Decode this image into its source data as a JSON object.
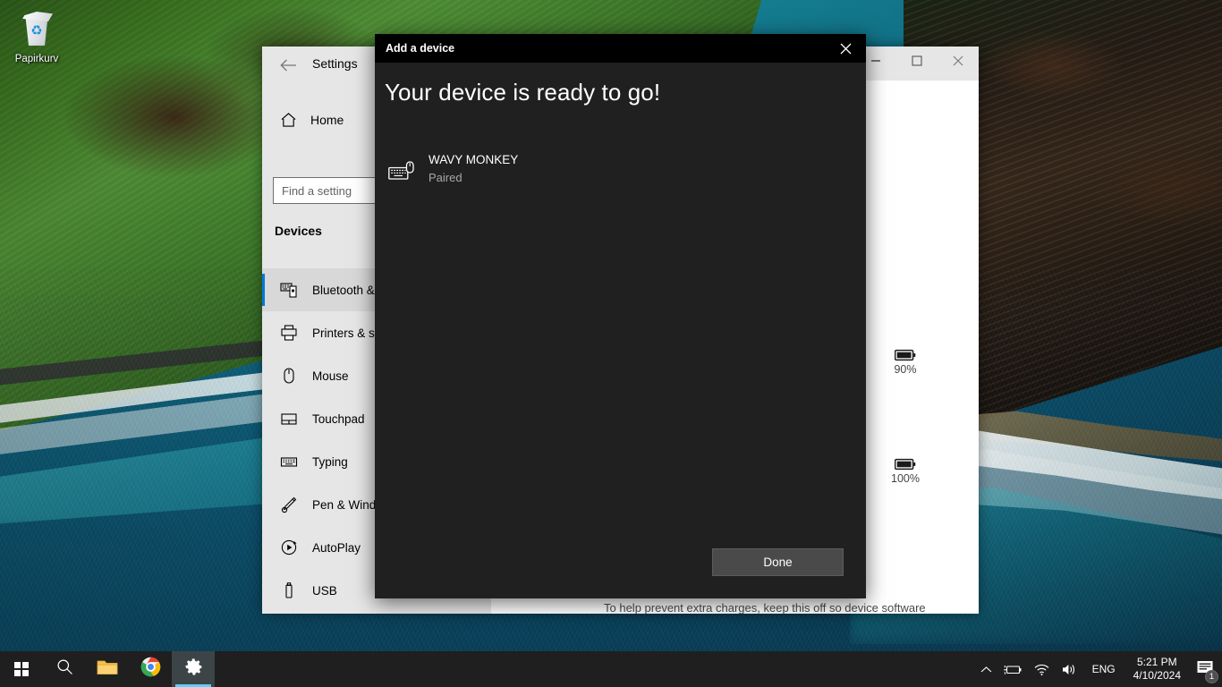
{
  "desktop": {
    "recycle_bin_label": "Papirkurv"
  },
  "settings_window": {
    "title": "Settings",
    "back_icon": "back-arrow-icon",
    "home": {
      "label": "Home",
      "icon": "home-icon"
    },
    "search": {
      "placeholder": "Find a setting",
      "value": ""
    },
    "group_label": "Devices",
    "nav_items": [
      {
        "label": "Bluetooth & ",
        "icon": "bluetooth-devices-icon",
        "active": true
      },
      {
        "label": "Printers & sca",
        "icon": "printer-icon",
        "active": false
      },
      {
        "label": "Mouse",
        "icon": "mouse-icon",
        "active": false
      },
      {
        "label": "Touchpad",
        "icon": "touchpad-icon",
        "active": false
      },
      {
        "label": "Typing",
        "icon": "keyboard-icon",
        "active": false
      },
      {
        "label": "Pen & Windo",
        "icon": "pen-icon",
        "active": false
      },
      {
        "label": "AutoPlay",
        "icon": "autoplay-icon",
        "active": false
      },
      {
        "label": "USB",
        "icon": "usb-icon",
        "active": false
      }
    ],
    "caption_buttons": {
      "minimize": "minimize-icon",
      "maximize": "maximize-icon",
      "close": "close-icon"
    },
    "content": {
      "battery_rows": [
        {
          "icon": "battery-full-icon",
          "level": "90%"
        },
        {
          "icon": "battery-full-icon",
          "level": "100%"
        }
      ],
      "note": "To help prevent extra charges, keep this off so device software"
    }
  },
  "add_device_dialog": {
    "title": "Add a device",
    "close_icon": "close-icon",
    "heading": "Your device is ready to go!",
    "device": {
      "icon": "keyboard-mouse-icon",
      "name": "WAVY MONKEY",
      "status": "Paired"
    },
    "done_label": "Done"
  },
  "taskbar": {
    "buttons": [
      {
        "name": "start-button",
        "icon": "windows-logo-icon",
        "active": false
      },
      {
        "name": "search-button",
        "icon": "search-icon",
        "active": false
      },
      {
        "name": "file-explorer-button",
        "icon": "folder-icon",
        "active": false
      },
      {
        "name": "chrome-button",
        "icon": "chrome-icon",
        "active": false
      },
      {
        "name": "settings-button",
        "icon": "gear-icon",
        "active": true
      }
    ],
    "tray": {
      "show_hidden_icon": "chevron-up-icon",
      "battery_icon": "battery-charging-icon",
      "network_icon": "wifi-icon",
      "volume_icon": "speaker-icon",
      "language": "ENG",
      "time": "5:21 PM",
      "date": "4/10/2024",
      "notification_icon": "action-center-icon",
      "notification_count": "1"
    }
  },
  "colors": {
    "accent": "#0078d7",
    "taskbar_bg": "#1f1f1f",
    "dialog_bg": "#202020",
    "dialog_titlebar": "#000000",
    "settings_bg": "#e6e6e6",
    "active_underline": "#60cdff"
  }
}
